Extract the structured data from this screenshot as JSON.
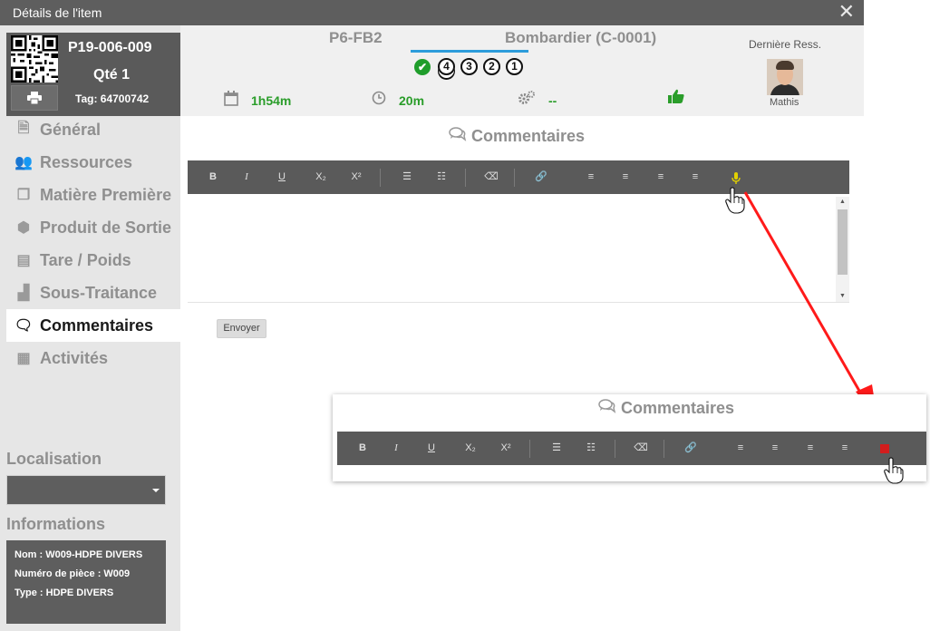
{
  "window": {
    "title": "Détails de l'item",
    "close_glyph": "✕"
  },
  "item": {
    "part_number": "P19-006-009",
    "quantity": "Qté 1",
    "tag": "Tag: 64700742",
    "print_icon": "printer-icon"
  },
  "sidebar": {
    "items": [
      {
        "label": "Général",
        "icon": "document-icon",
        "glyph": "🗎"
      },
      {
        "label": "Ressources",
        "icon": "users-icon",
        "glyph": "👥"
      },
      {
        "label": "Matière Première",
        "icon": "cubes-icon",
        "glyph": "❒"
      },
      {
        "label": "Produit de Sortie",
        "icon": "cube-icon",
        "glyph": "⬢"
      },
      {
        "label": "Tare / Poids",
        "icon": "archive-icon",
        "glyph": "▤"
      },
      {
        "label": "Sous-Traitance",
        "icon": "industry-icon",
        "glyph": "▟"
      },
      {
        "label": "Commentaires",
        "icon": "comments-icon",
        "glyph": "🗨",
        "active": true
      },
      {
        "label": "Activités",
        "icon": "list-icon",
        "glyph": "▦"
      }
    ],
    "location_label": "Localisation",
    "location_value": "",
    "info_label": "Informations",
    "info": {
      "name": "Nom : W009-HDPE DIVERS",
      "part_no": "Numéro de pièce : W009",
      "type": "Type : HDPE DIVERS"
    }
  },
  "header": {
    "operation": "P6-FB2",
    "client": "Bombardier (C-0001)",
    "steps": [
      "4",
      "3",
      "2",
      "1"
    ],
    "check_glyph": "✔",
    "time_total": "1h54m",
    "time_elapsed": "20m",
    "settings_value": "--",
    "last_resource_label": "Dernière Ress.",
    "last_resource_name": "Mathis",
    "accent_color": "#2d9cdb",
    "status_color": "#2a9d2a"
  },
  "comments": {
    "title": "Commentaires",
    "toolbar": {
      "bold": "B",
      "italic": "I",
      "underline": "U",
      "subscript": "X₂",
      "superscript": "X²",
      "bullet_list": "☰",
      "numbered_list": "☷",
      "remove_format": "⌫",
      "link": "🔗",
      "align_left": "≡",
      "align_center": "≡",
      "align_right": "≡",
      "justify": "≡",
      "mic": "🎙"
    },
    "send_label": "Envoyer"
  },
  "callout": {
    "title": "Commentaires",
    "recording_color": "#d21d1d"
  }
}
